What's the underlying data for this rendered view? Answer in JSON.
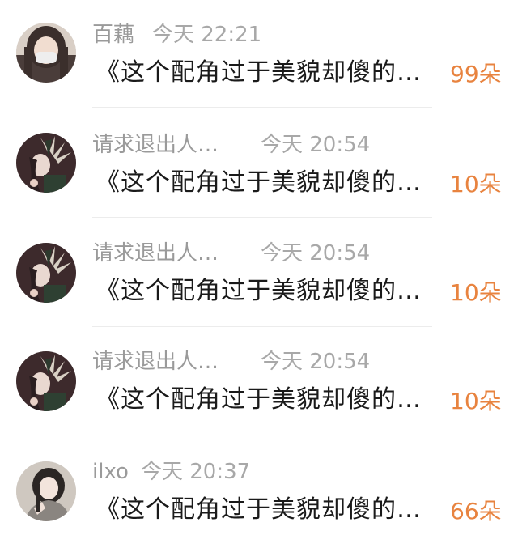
{
  "items": [
    {
      "username": "百藕",
      "time": "今天 22:21",
      "title": "《这个配角过于美貌却傻的…",
      "count": "99朵",
      "avatar_icon": "avatar-girl-mask"
    },
    {
      "username": "请求退出人…",
      "time": "今天 20:54",
      "title": "《这个配角过于美貌却傻的…",
      "count": "10朵",
      "avatar_icon": "avatar-feather-character"
    },
    {
      "username": "请求退出人…",
      "time": "今天 20:54",
      "title": "《这个配角过于美貌却傻的…",
      "count": "10朵",
      "avatar_icon": "avatar-feather-character"
    },
    {
      "username": "请求退出人…",
      "time": "今天 20:54",
      "title": "《这个配角过于美貌却傻的…",
      "count": "10朵",
      "avatar_icon": "avatar-feather-character"
    },
    {
      "username": "ilxo",
      "time": "今天 20:37",
      "title": "《这个配角过于美貌却傻的…",
      "count": "66朵",
      "avatar_icon": "avatar-girl-portrait"
    }
  ],
  "colors": {
    "count_accent": "#e8833f",
    "username": "#9a9a9a",
    "time": "#a8a8a8",
    "title": "#1a1a1a"
  }
}
